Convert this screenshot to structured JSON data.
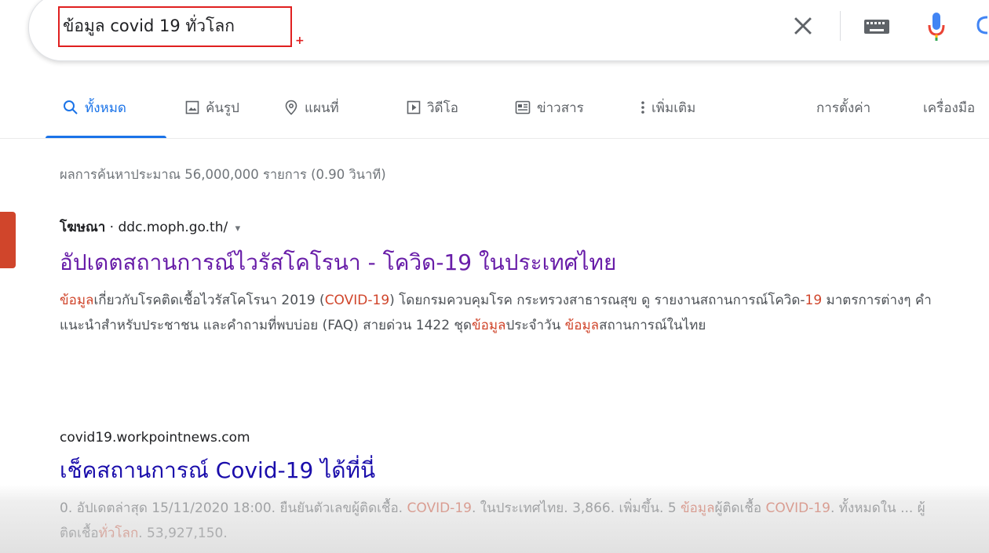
{
  "search": {
    "query": "ข้อมูล covid 19 ทั่วโลก",
    "clear_icon": "close-icon",
    "keyboard_icon": "keyboard-icon",
    "mic_icon": "microphone-icon",
    "lens_icon": "google-lens-icon"
  },
  "tabs": {
    "all": "ทั้งหมด",
    "images": "ค้นรูป",
    "maps": "แผนที่",
    "videos": "วิดีโอ",
    "news": "ข่าวสาร",
    "more": "เพิ่มเติม",
    "settings": "การตั้งค่า",
    "tools": "เครื่องมือ"
  },
  "stats": "ผลการค้นหาประมาณ 56,000,000 รายการ (0.90 วินาที)",
  "results": [
    {
      "ad_label": "โฆษณา",
      "separator": " · ",
      "url": "ddc.moph.go.th/",
      "dropdown": "▾",
      "title": "อัปเดตสถานการณ์ไวรัสโคโรนา - โควิด-19 ในประเทศไทย",
      "snippet": [
        {
          "hl": true,
          "text": "ข้อมูล"
        },
        {
          "hl": false,
          "text": "เกี่ยวกับโรคติดเชื้อไวรัสโคโรนา 2019 ("
        },
        {
          "hl": true,
          "text": "COVID-19"
        },
        {
          "hl": false,
          "text": ") โดยกรมควบคุมโรค กระทรวงสาธารณสุข ดู รายงานสถานการณ์โควิด-"
        },
        {
          "hl": true,
          "text": "19"
        },
        {
          "hl": false,
          "text": " มาตรการต่างๆ คำแนะนำสำหรับประชาชน และคำถามที่พบบ่อย (FAQ) สายด่วน 1422 ชุด"
        },
        {
          "hl": true,
          "text": "ข้อมูล"
        },
        {
          "hl": false,
          "text": "ประจำวัน "
        },
        {
          "hl": true,
          "text": "ข้อมูล"
        },
        {
          "hl": false,
          "text": "สถานการณ์ในไทย"
        }
      ]
    },
    {
      "url": "covid19.workpointnews.com",
      "title": "เช็คสถานการณ์ Covid-19 ได้ที่นี่",
      "snippet": [
        {
          "hl": false,
          "text": "0. อัปเดตล่าสุด 15/11/2020 18:00. ยืนยันตัวเลขผู้ติดเชื้อ. "
        },
        {
          "hl": true,
          "text": "COVID-19"
        },
        {
          "hl": false,
          "text": ". ในประเทศไทย. 3,866. เพิ่มขึ้น. 5 "
        },
        {
          "hl": true,
          "text": "ข้อมูล"
        },
        {
          "hl": false,
          "text": "ผู้ติดเชื้อ "
        },
        {
          "hl": true,
          "text": "COVID-19"
        },
        {
          "hl": false,
          "text": ". ทั้งหมดใน ... ผู้ติดเชื้อ"
        },
        {
          "hl": true,
          "text": "ทั่วโลก"
        },
        {
          "hl": false,
          "text": ". 53,927,150."
        }
      ]
    }
  ],
  "colors": {
    "accent_blue": "#1a73e8",
    "link_visited": "#681da8",
    "link": "#1a0dab",
    "highlight": "#d0452b",
    "query_box_border": "#e02020"
  }
}
